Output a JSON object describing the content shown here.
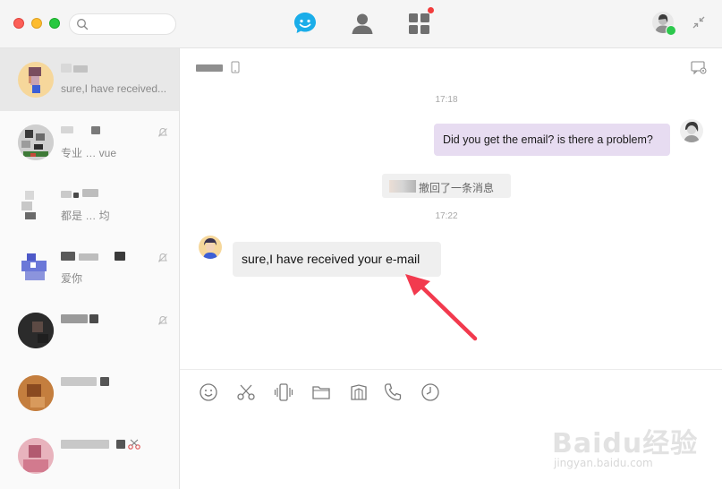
{
  "search": {
    "placeholder": ""
  },
  "colors": {
    "accent": "#1aade9",
    "out_bubble": "#e7dcf1",
    "in_bubble": "#efefef",
    "online": "#2dc84d",
    "badge": "#f23c3c",
    "annotation_arrow": "#f23a4e"
  },
  "nav": [
    "chat-icon",
    "contacts-icon",
    "apps-icon"
  ],
  "sidebar": {
    "conversations": [
      {
        "name": "",
        "preview": "sure,I have received...",
        "active": true
      },
      {
        "name": "",
        "preview": "专业 … vue",
        "muted": true
      },
      {
        "name": "",
        "preview": "都是 … 均"
      },
      {
        "name": "",
        "preview": "爱你",
        "muted": true
      },
      {
        "name": "",
        "preview": "",
        "muted": true
      },
      {
        "name": "",
        "preview": ""
      },
      {
        "name": "",
        "preview": ""
      }
    ]
  },
  "chat": {
    "messages": [
      {
        "type": "time",
        "text": "17:18"
      },
      {
        "type": "outgoing",
        "text": "Did you get the email? is there a problem?"
      },
      {
        "type": "system",
        "text": "撤回了一条消息"
      },
      {
        "type": "time",
        "text": "17:22"
      },
      {
        "type": "incoming",
        "text": "sure,I have received your e-mail"
      }
    ]
  },
  "toolbar": {
    "tools": [
      "emoji-icon",
      "screenshot-scissors-icon",
      "shake-window-icon",
      "file-folder-icon",
      "image-icon",
      "phone-call-icon",
      "history-clock-icon"
    ]
  },
  "watermark": {
    "logo_text": "Baidu经验",
    "url": "jingyan.baidu.com"
  }
}
